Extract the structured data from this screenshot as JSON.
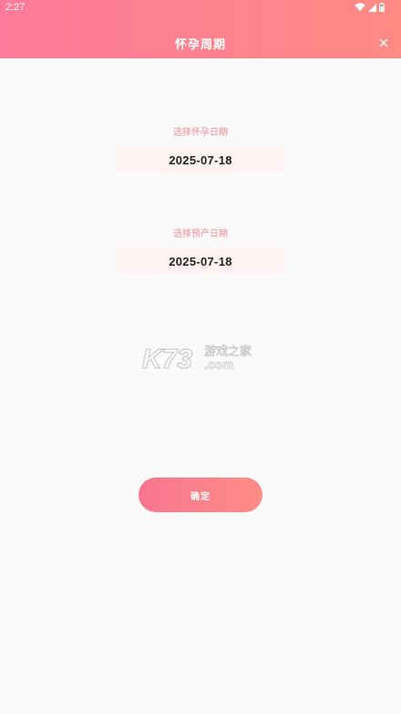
{
  "status_bar": {
    "time": "2:27"
  },
  "header": {
    "title": "怀孕周期"
  },
  "pregnancy_date": {
    "label": "选择怀孕日期",
    "value": "2025-07-18"
  },
  "due_date": {
    "label": "选择预产日期",
    "value": "2025-07-18"
  },
  "watermark": {
    "brand": "K73",
    "tagline": "游戏之家",
    "suffix": ".com"
  },
  "confirm": {
    "label": "确定"
  },
  "colors": {
    "header_gradient_start": "#fd7a9a",
    "header_gradient_end": "#fe8a84",
    "label_pink": "#f08d98",
    "date_box_bg": "#fff4f3",
    "page_bg": "#fafafa"
  }
}
